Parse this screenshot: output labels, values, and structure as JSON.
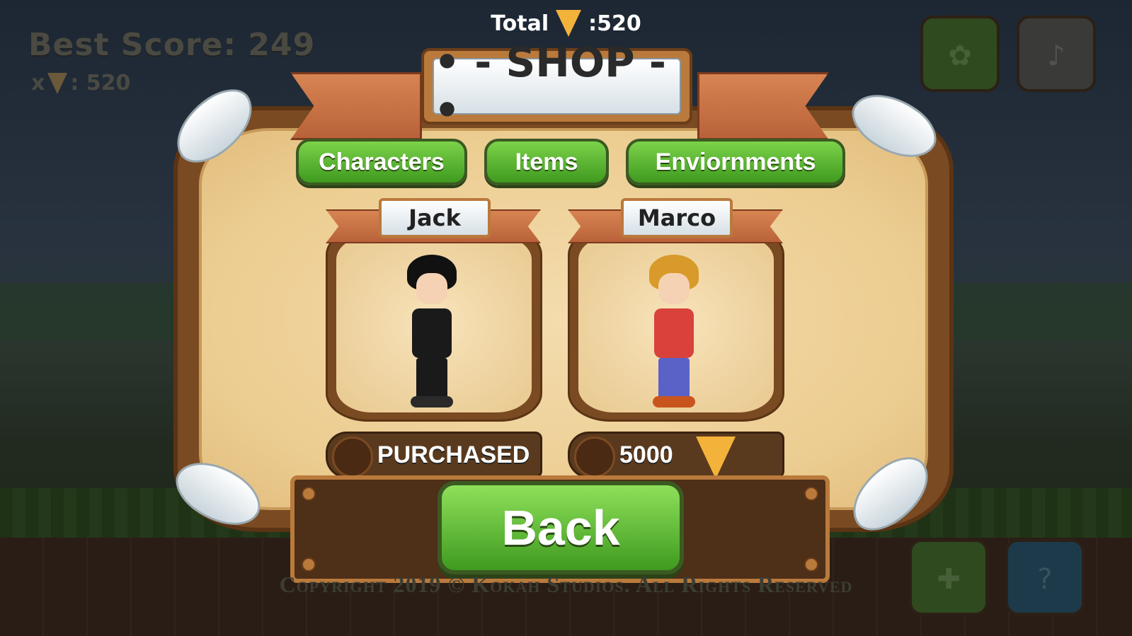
{
  "hud": {
    "best_score_label": "Best Score: 249",
    "pizza_prefix": "x",
    "pizza_count": ": 520",
    "total_label": "Total",
    "total_value": ":520"
  },
  "shop": {
    "title": "• - SHOP - •",
    "tabs": [
      {
        "label": "Characters"
      },
      {
        "label": "Items"
      },
      {
        "label": "Enviornments"
      }
    ],
    "characters": [
      {
        "name": "Jack",
        "status": "PURCHASED",
        "hair_color": "#111111",
        "body_color": "#1a1a1a",
        "legs_color": "#1a1a1a"
      },
      {
        "name": "Marco",
        "price": "5000",
        "hair_color": "#d89a2a",
        "body_color": "#d8423a",
        "legs_color": "#5a62c8"
      }
    ],
    "back_label": "Back"
  },
  "footer": {
    "copyright": "Copyright 2019 © Kokah Studios. All Rights Reserved"
  },
  "icons": {
    "currency": "pizza-icon",
    "corner_top_left": "leaf-icon",
    "corner_top_right": "music-note-icon",
    "corner_bottom_left": "controller-icon",
    "corner_bottom_right": "question-icon"
  },
  "colors": {
    "tab_green": "#5bb832",
    "ribbon": "#c8703f",
    "panel": "#eccd91"
  }
}
